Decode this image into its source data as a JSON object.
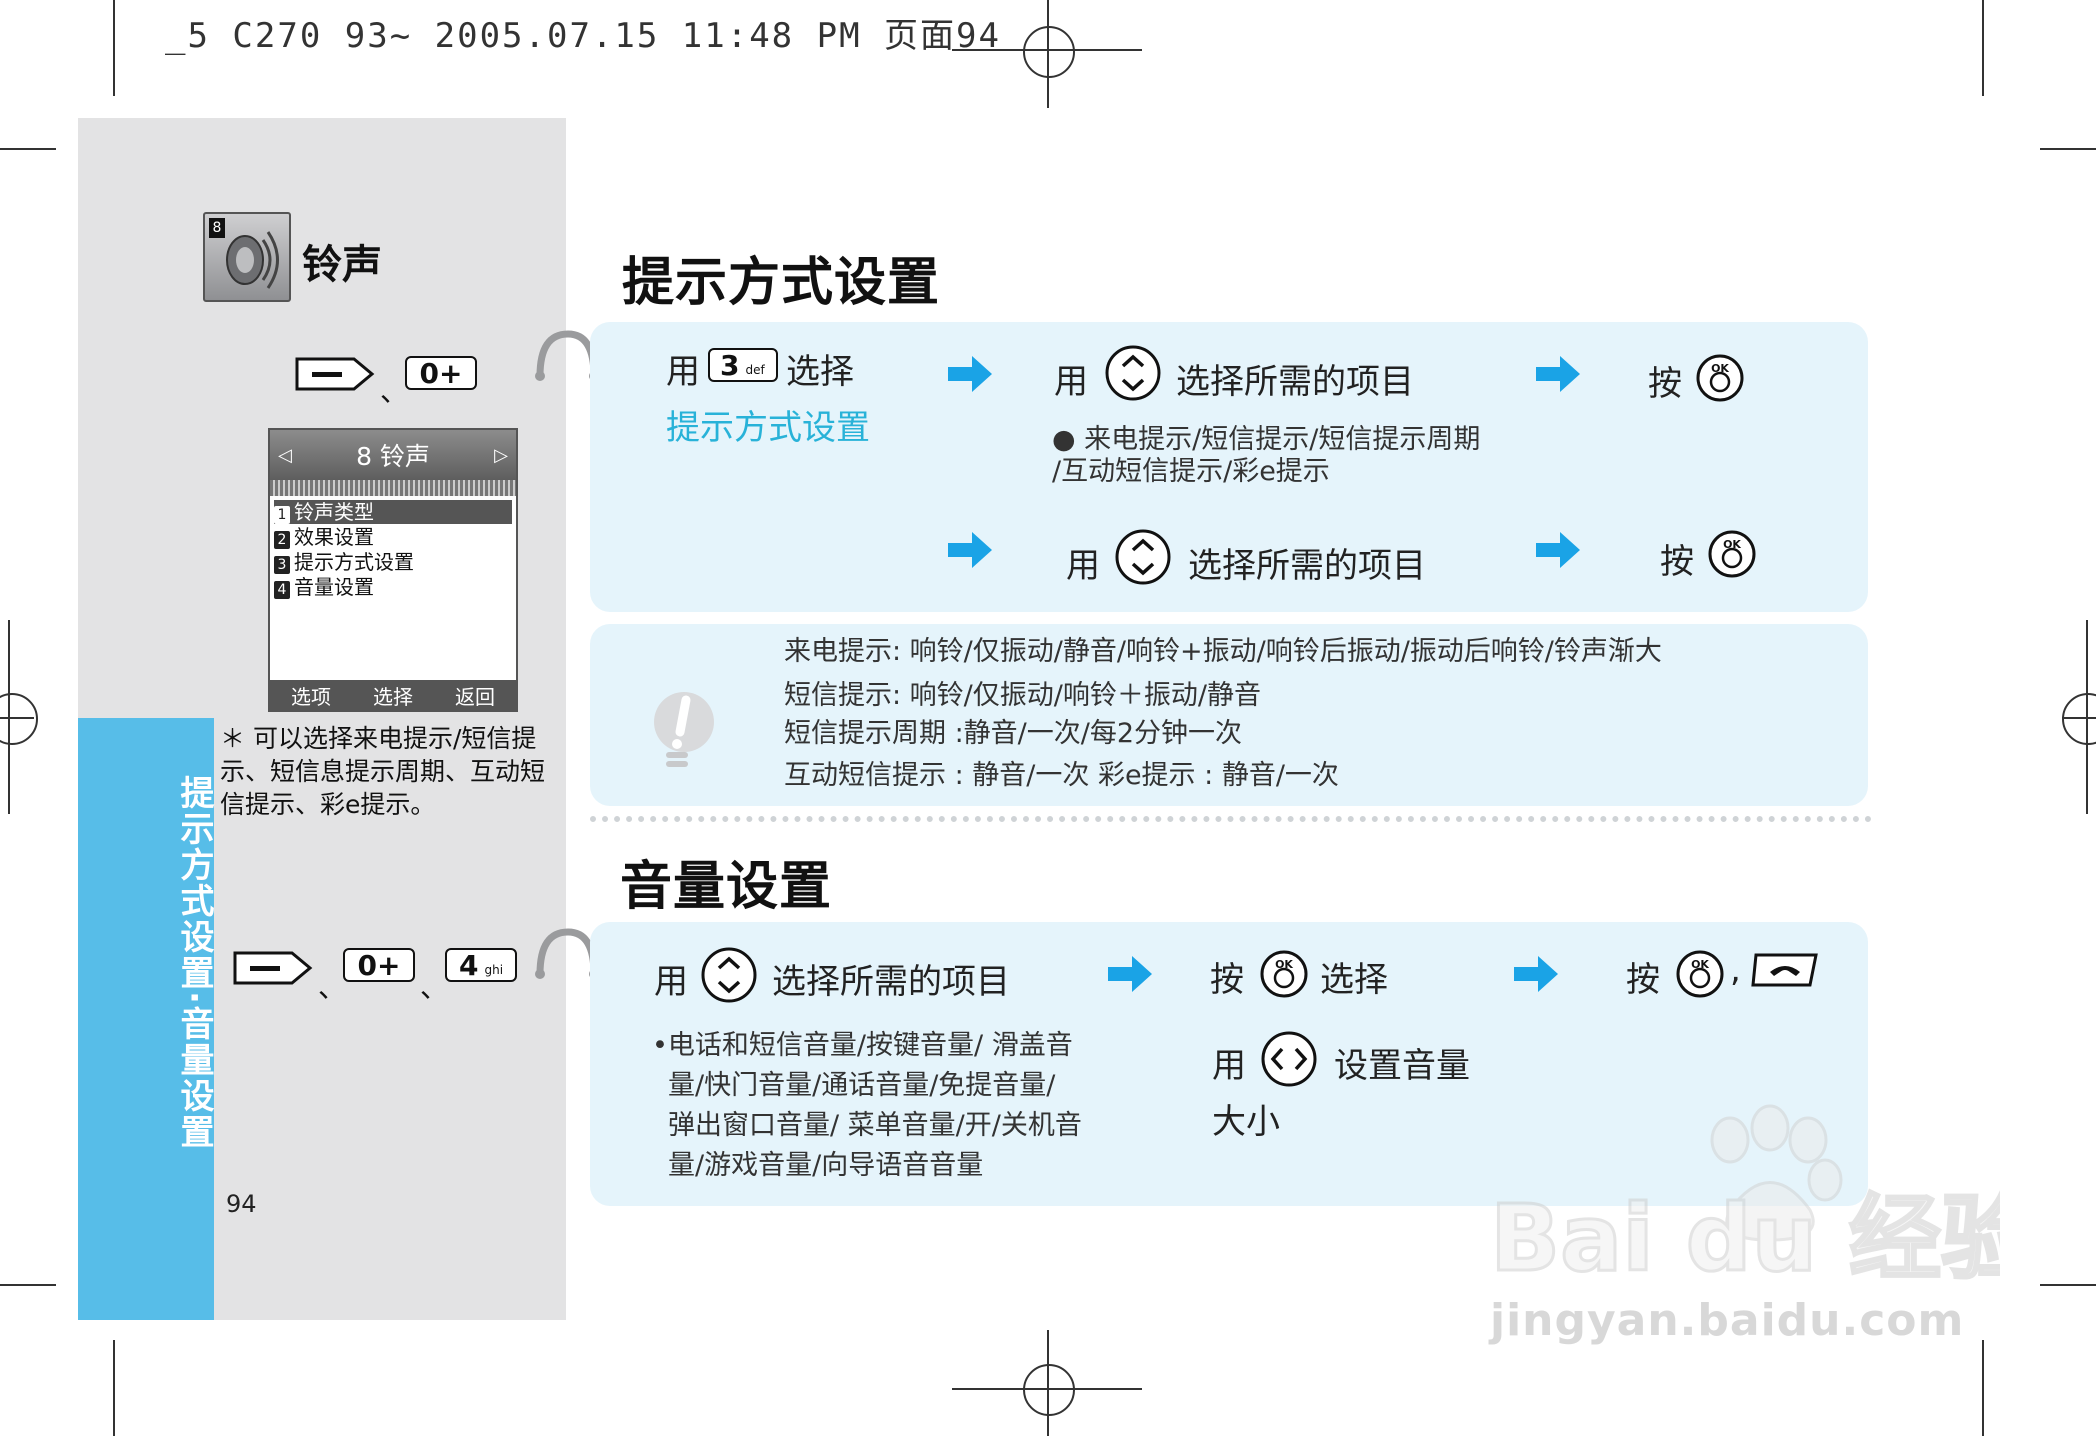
{
  "print_header": "_5 C270 93~ 2005.07.15 11:48 PM 页面94",
  "sidebar": {
    "menu_icon_badge": "8",
    "menu_title": "铃声",
    "key_zero": "0+",
    "key_zero_2": "0+",
    "key_four": "4",
    "key_four_sub": "ghi",
    "separator": "、",
    "phone": {
      "header": "8 铃声",
      "items": [
        {
          "num": "1",
          "label": "铃声类型"
        },
        {
          "num": "2",
          "label": "效果设置"
        },
        {
          "num": "3",
          "label": "提示方式设置"
        },
        {
          "num": "4",
          "label": "音量设置"
        }
      ],
      "softkeys": [
        "选项",
        "选择",
        "返回"
      ]
    },
    "note": "＊ 可以选择来电提示/短信提示、短信息提示周期、互动短信提示、彩e提示。",
    "vertical_label": "提示方式设置·音量设置",
    "page_number": "94"
  },
  "section1": {
    "heading": "提示方式设置",
    "step1_use": "用",
    "key_three": "3",
    "key_three_sub": "def",
    "step1_select": "选择",
    "step1_target": "提示方式设置",
    "step2_use": "用",
    "step2_text": "选择所需的项目",
    "step2_options": "● 来电提示/短信提示/短信提示周期",
    "step2_options_2": "/互动短信提示/彩e提示",
    "step3_press": "按",
    "step4_use": "用",
    "step4_text": "选择所需的项目",
    "step5_press": "按",
    "ok_label": "OK"
  },
  "tips": {
    "lines": [
      "来电提示:  响铃/仅振动/静音/响铃+振动/响铃后振动/振动后响铃/铃声渐大",
      "短信提示:  响铃/仅振动/响铃＋振动/静音",
      "短信提示周期  :静音/一次/每2分钟一次",
      "互动短信提示 :  静音/一次    彩e提示 :  静音/一次"
    ]
  },
  "section2": {
    "heading": "音量设置",
    "step1_use": "用",
    "step1_text": "选择所需的项目",
    "bullet_lines": [
      "•电话和短信音量/按键音量/ 滑盖音",
      "量/快门音量/通话音量/免提音量/",
      "弹出窗口音量/ 菜单音量/开/关机音",
      "量/游戏音量/向导语音音量"
    ],
    "step2_press": "按",
    "step2_select": "选择",
    "step3_use": "用",
    "step3_text": "设置音量",
    "step3_text2": "大小",
    "step4_press": "按",
    "step4_comma": ","
  },
  "watermark": {
    "logo": "Bai du 经验",
    "url": "jingyan.baidu.com"
  },
  "colors": {
    "accent_blue": "#57bde8",
    "panel_bg": "#e5f4fb",
    "arrow_blue": "#1aa3e6",
    "link_cyan": "#28b2d8"
  }
}
